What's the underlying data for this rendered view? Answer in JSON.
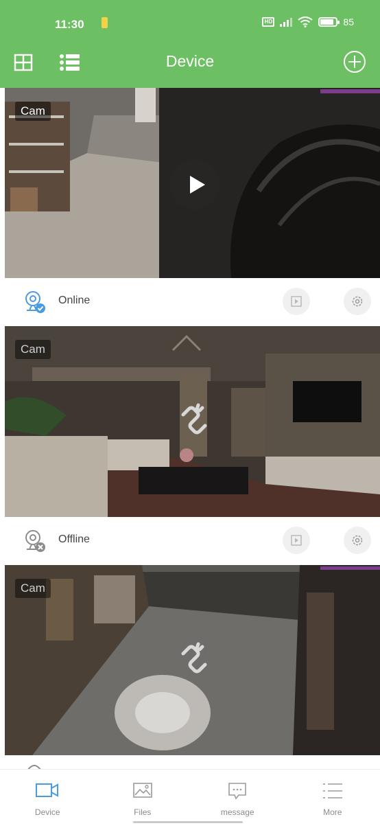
{
  "status_bar": {
    "time": "11:30",
    "battery": "85",
    "battery_level": 0.85
  },
  "header": {
    "title": "Device",
    "accent_color": "#6cc063"
  },
  "devices": [
    {
      "name": "Cam",
      "status": "Online",
      "state": "live"
    },
    {
      "name": "Cam",
      "status": "Offline",
      "state": "disconnected"
    },
    {
      "name": "Cam",
      "state": "disconnected"
    }
  ],
  "bottom_nav": {
    "items": [
      {
        "label": "Device",
        "icon": "camera-icon",
        "active": true
      },
      {
        "label": "Files",
        "icon": "image-icon",
        "active": false
      },
      {
        "label": "message",
        "icon": "message-icon",
        "active": false
      },
      {
        "label": "More",
        "icon": "menu-icon",
        "active": false
      }
    ],
    "active_color": "#4a9be0"
  }
}
